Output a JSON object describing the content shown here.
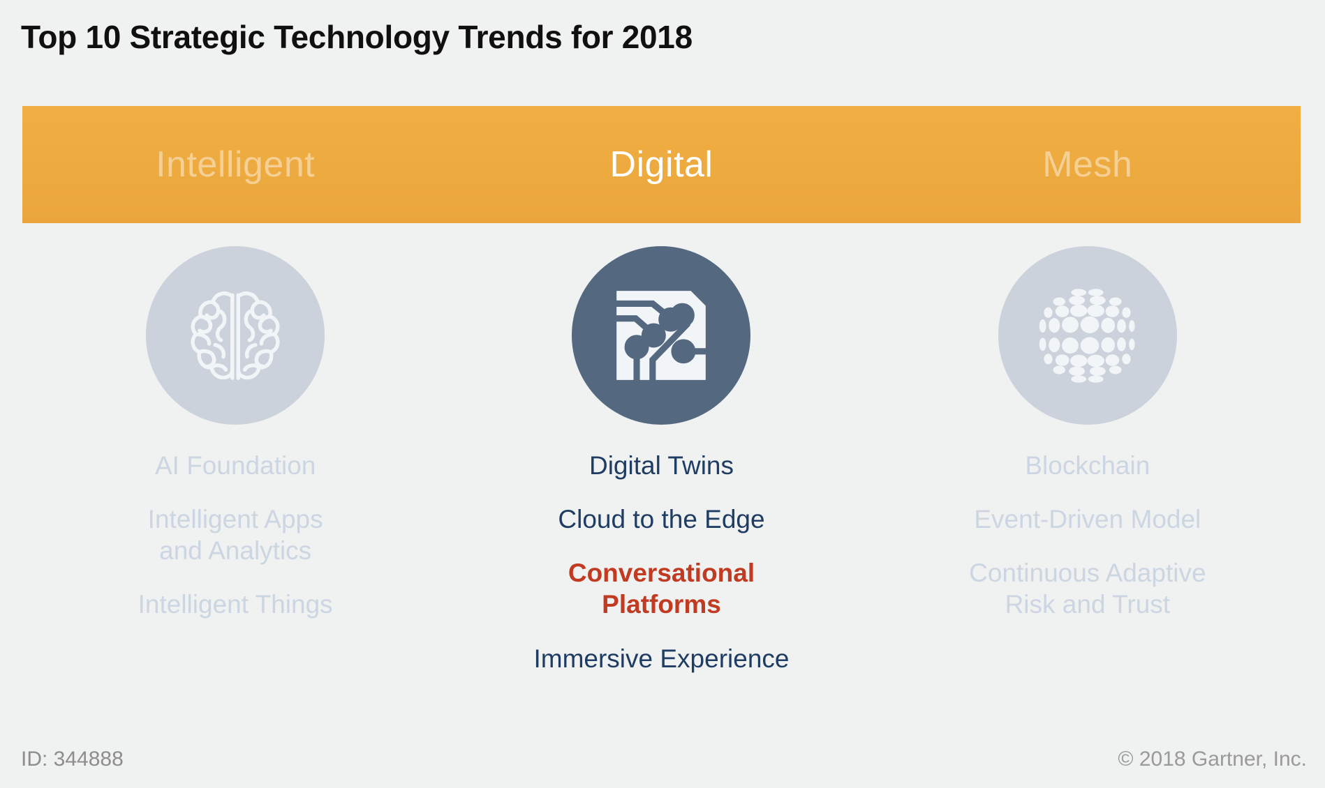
{
  "page": {
    "title": "Top 10 Strategic Technology Trends for 2018",
    "background_color": "#F0F1F1"
  },
  "banner": {
    "background_color": "#EDAA3F",
    "categories": [
      {
        "label": "Intelligent",
        "active": false
      },
      {
        "label": "Digital",
        "active": true
      },
      {
        "label": "Mesh",
        "active": false
      }
    ]
  },
  "columns": [
    {
      "category": "Intelligent",
      "active": false,
      "icon": "brain-icon",
      "icon_circle_color": "#CCD2DB",
      "trends": [
        {
          "label": "AI Foundation",
          "highlight": false
        },
        {
          "label": "Intelligent Apps\nand Analytics",
          "highlight": false
        },
        {
          "label": "Intelligent Things",
          "highlight": false
        }
      ]
    },
    {
      "category": "Digital",
      "active": true,
      "icon": "circuit-board-icon",
      "icon_circle_color": "#546880",
      "trends": [
        {
          "label": "Digital Twins",
          "highlight": false
        },
        {
          "label": "Cloud to the Edge",
          "highlight": false
        },
        {
          "label": "Conversational\nPlatforms",
          "highlight": true
        },
        {
          "label": "Immersive Experience",
          "highlight": false
        }
      ]
    },
    {
      "category": "Mesh",
      "active": false,
      "icon": "globe-mesh-icon",
      "icon_circle_color": "#CCD2DB",
      "trends": [
        {
          "label": "Blockchain",
          "highlight": false
        },
        {
          "label": "Event-Driven Model",
          "highlight": false
        },
        {
          "label": "Continuous Adaptive\nRisk and Trust",
          "highlight": false
        }
      ]
    }
  ],
  "footer": {
    "id": "ID: 344888",
    "copyright": "© 2018 Gartner, Inc."
  },
  "colors": {
    "accent_orange": "#EDAA3F",
    "active_slate": "#546880",
    "navy_text": "#1F3D63",
    "highlight_red": "#C13A22",
    "dim_text": "#CCD6E2",
    "footer_text": "#8D8D8D"
  }
}
